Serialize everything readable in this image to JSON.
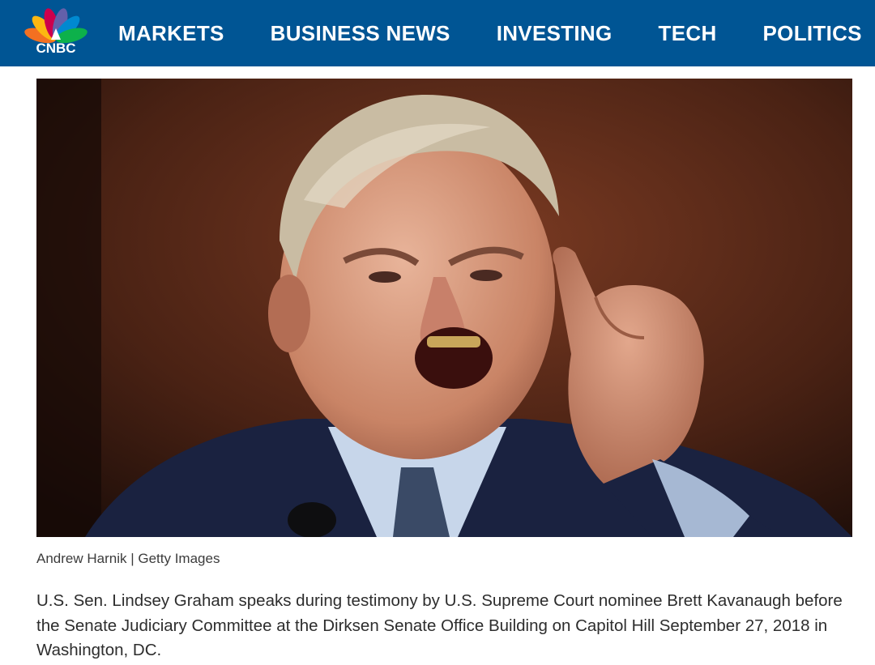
{
  "brand": {
    "name": "CNBC"
  },
  "nav": {
    "items": [
      {
        "label": "MARKETS"
      },
      {
        "label": "BUSINESS NEWS"
      },
      {
        "label": "INVESTING"
      },
      {
        "label": "TECH"
      },
      {
        "label": "POLITICS"
      }
    ]
  },
  "article": {
    "image_credit": "Andrew Harnik | Getty Images",
    "caption": "U.S. Sen. Lindsey Graham speaks during testimony by U.S. Supreme Court nominee Brett Kavanaugh before the Senate Judiciary Committee at the Dirksen Senate Office Building on Capitol Hill September 27, 2018 in Washington, DC."
  },
  "colors": {
    "nav_background": "#005594",
    "nav_text": "#ffffff",
    "caption_text": "#2d2d2d"
  }
}
